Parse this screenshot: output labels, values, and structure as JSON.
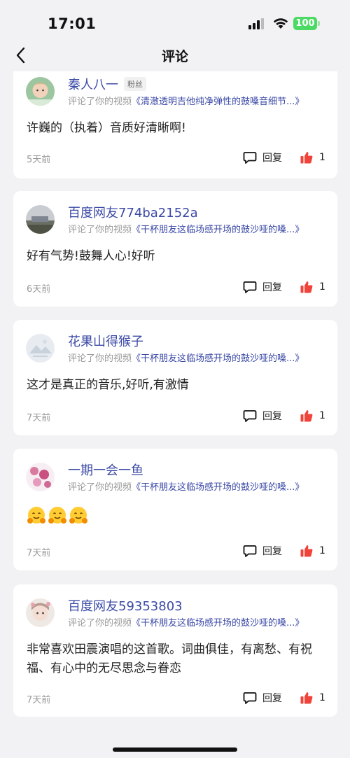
{
  "status": {
    "time": "17:01",
    "battery": "100"
  },
  "header": {
    "title": "评论"
  },
  "comments": [
    {
      "user": "秦人八一",
      "badge": "粉丝",
      "prefix": "评论了你的视频",
      "video": "《清澈透明吉他纯净弹性的鼓嗓音细节...》",
      "text": "许巍的（执着）音质好清晰啊!",
      "time": "5天前",
      "reply": "回复",
      "likes": "1"
    },
    {
      "user": "百度网友774ba2152a",
      "prefix": "评论了你的视频",
      "video": "《干杯朋友这临场感开场的鼓沙哑的嗓...》",
      "text": "好有气势!鼓舞人心!好听",
      "time": "6天前",
      "reply": "回复",
      "likes": "1"
    },
    {
      "user": "花果山得猴子",
      "prefix": "评论了你的视频",
      "video": "《干杯朋友这临场感开场的鼓沙哑的嗓...》",
      "text": "这才是真正的音乐,好听,有激情",
      "time": "7天前",
      "reply": "回复",
      "likes": "1"
    },
    {
      "user": "一期一会一鱼",
      "prefix": "评论了你的视频",
      "video": "《干杯朋友这临场感开场的鼓沙哑的嗓...》",
      "emoji": "hugging-face-emoji x3",
      "time": "7天前",
      "reply": "回复",
      "likes": "1"
    },
    {
      "user": "百度网友59353803",
      "prefix": "评论了你的视频",
      "video": "《干杯朋友这临场感开场的鼓沙哑的嗓...》",
      "text": "非常喜欢田震演唱的这首歌。词曲俱佳，有离愁、有祝福、有心中的无尽思念与眷恋",
      "time": "7天前",
      "reply": "回复",
      "likes": "1"
    }
  ],
  "colors": {
    "accent": "#3b4aa6",
    "like": "#f0433a",
    "battery": "#4cd964"
  }
}
